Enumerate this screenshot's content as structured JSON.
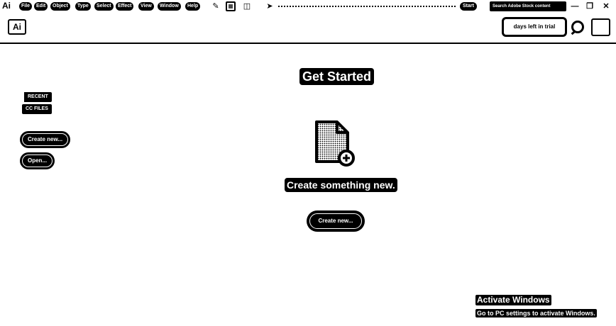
{
  "menubar": {
    "app_icon": "Ai",
    "items": [
      "File",
      "Edit",
      "Object",
      "Type",
      "Select",
      "Effect",
      "View",
      "Window",
      "Help"
    ],
    "tool_icons": [
      "brush-icon",
      "grid-icon",
      "arrange-icon",
      "send-icon"
    ],
    "start_label": "Start",
    "search_placeholder": "Search Adobe Stock content",
    "window_controls": [
      "—",
      "❐",
      "✕"
    ]
  },
  "header": {
    "logo": "Ai",
    "trial_label": "days left in trial",
    "help_icon": "search-help-icon",
    "profile_icon": "profile-icon"
  },
  "sidebar": {
    "tabs": [
      "RECENT",
      "CC FILES"
    ],
    "create_label": "Create new...",
    "open_label": "Open..."
  },
  "main": {
    "title": "Get Started",
    "subtitle": "Create something new.",
    "create_label": "Create new...",
    "doc_icon": "new-document-icon"
  },
  "watermark": {
    "line1": "Activate Windows",
    "line2": "Go to PC settings to activate Windows."
  }
}
